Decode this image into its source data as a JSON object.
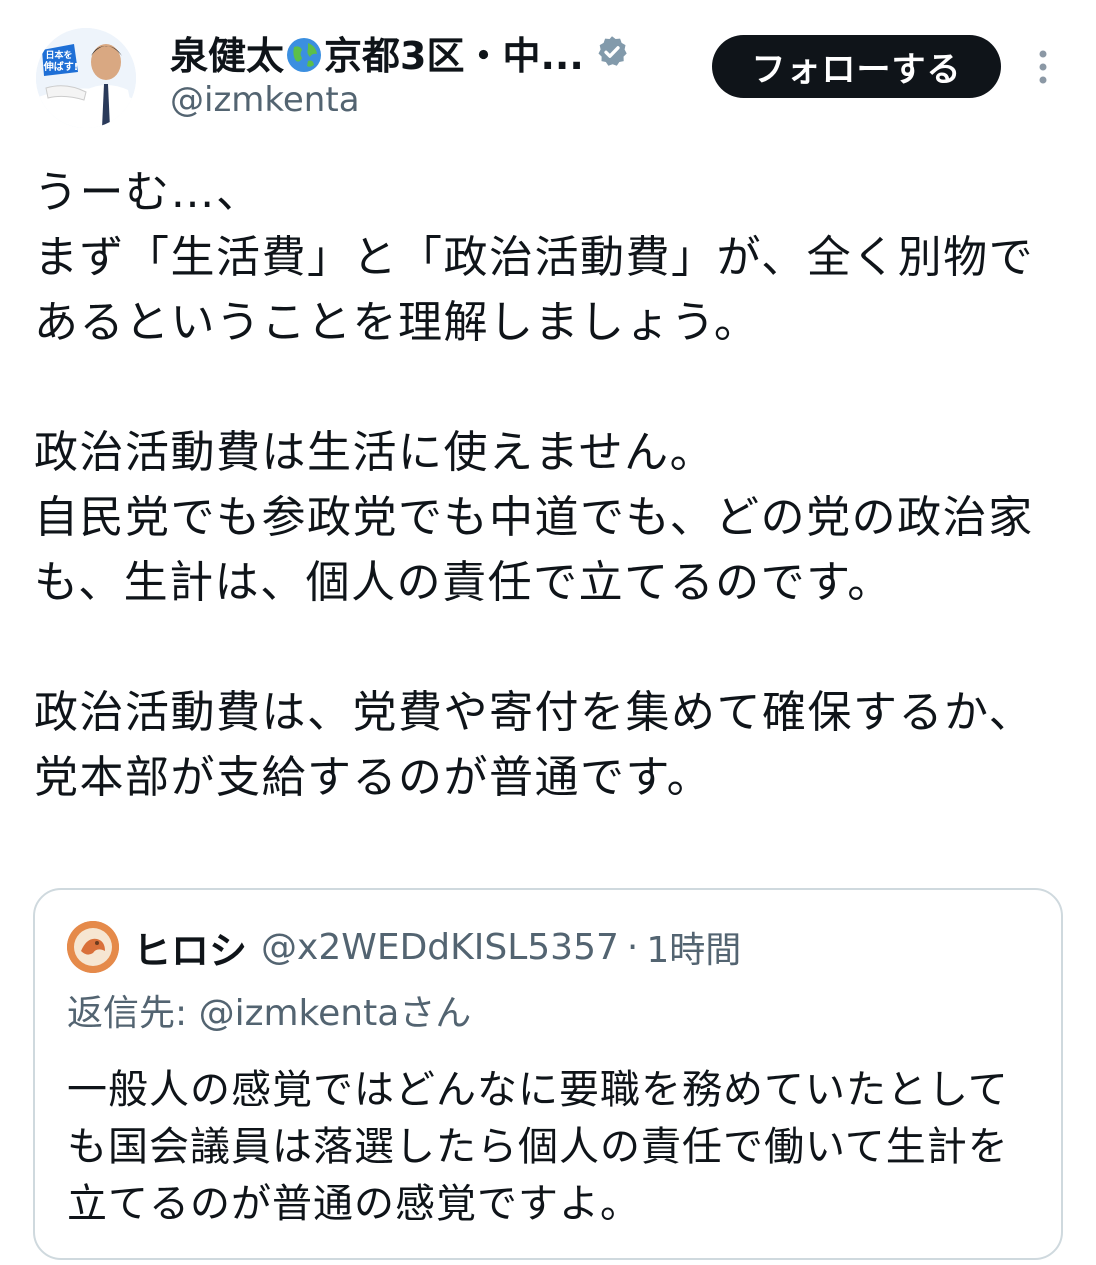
{
  "author": {
    "display_name": "泉健太",
    "display_name_suffix": "京都3区・中...",
    "handle": "@izmkenta",
    "avatar_banner_text": "日本を伸ばす!",
    "icons": [
      "globe-icon",
      "verified-icon"
    ],
    "verified_color": "#829aab"
  },
  "actions": {
    "follow_label": "フォローする",
    "more_icon": "more-vertical-icon"
  },
  "tweet": {
    "paragraphs": [
      "うーむ…、",
      "まず「生活費」と「政治活動費」が、全く別物であるということを理解しましょう。",
      "",
      "政治活動費は生活に使えません。",
      "自民党でも参政党でも中道でも、どの党の政治家も、生計は、個人の責任で立てるのです。",
      "",
      "政治活動費は、党費や寄付を集めて確保するか、党本部が支給するのが普通です。"
    ]
  },
  "quoted_tweet": {
    "name": "ヒロシ",
    "handle": "@x2WEDdKISL5357",
    "separator": "·",
    "time": "1時間",
    "reply_prefix": "返信先: ",
    "reply_handle": "@izmkentaさん",
    "text": "一般人の感覚ではどんなに要職を務めていたとしても国会議員は落選したら個人の責任で働いて生計を立てるのが普通の感覚ですよ。"
  },
  "colors": {
    "text": "#0f1419",
    "secondary": "#536471",
    "button_bg": "#0f1419",
    "border": "#cfd9de"
  }
}
